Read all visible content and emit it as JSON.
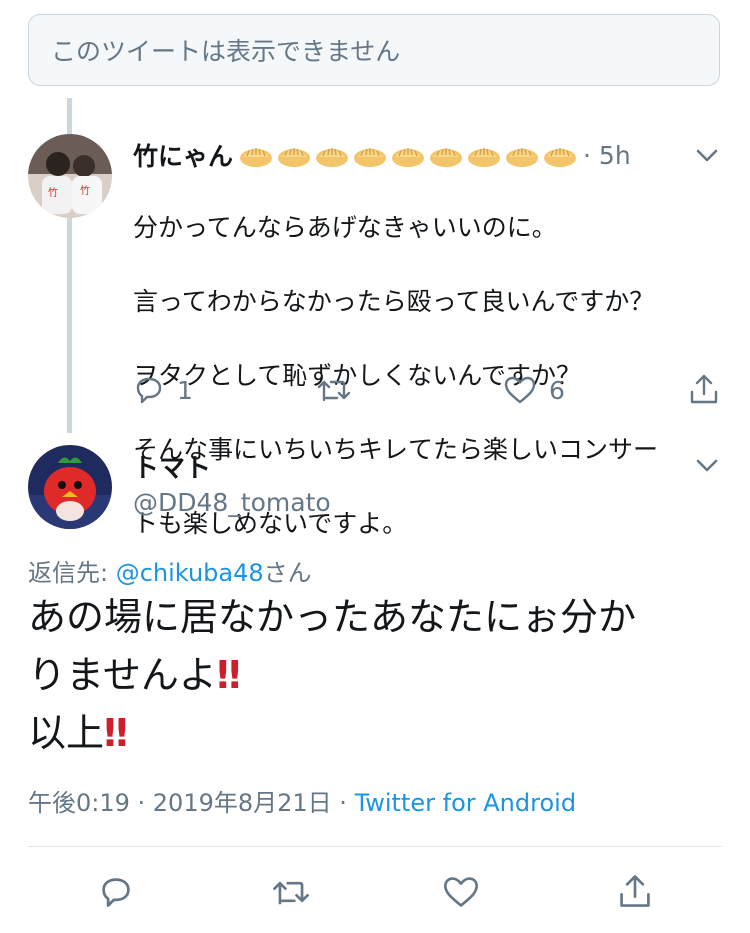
{
  "notice": {
    "unavailable_text": "このツイートは表示できません"
  },
  "parent_tweet": {
    "display_name": "竹にゃん",
    "emoji_count_visible": 9,
    "emoji_name": "dumpling-emoji",
    "time": "· 5h",
    "lines": [
      "分かってんならあげなきゃいいのに。",
      "言ってわからなかったら殴って良いんですか？",
      "ヲタクとして恥ずかしくないんですか？",
      "そんな事にいちいちキレてたら楽しいコンサー",
      "トも楽しめないですよ。"
    ],
    "reply_count": "1",
    "like_count": "6"
  },
  "main_tweet": {
    "display_name": "トマト",
    "handle": "@DD48_tomato",
    "replying_prefix": "返信先: ",
    "replying_mention": "@chikuba48",
    "replying_suffix": "さん",
    "text_part1": "あの場に居なかったあなたにぉ分か\nりませんよ",
    "text_part2": "\n以上",
    "exclaim": "‼",
    "timestamp": "午後0:19 · 2019年8月21日 · ",
    "source": "Twitter for Android"
  },
  "colors": {
    "link": "#1b95e0",
    "secondary": "#657786",
    "primary": "#14171a",
    "thread_line": "#ccd6dd",
    "exclaim": "#cc1f2b"
  },
  "icons": [
    "chevron-down-icon",
    "reply-icon",
    "retweet-icon",
    "like-icon",
    "share-icon"
  ]
}
